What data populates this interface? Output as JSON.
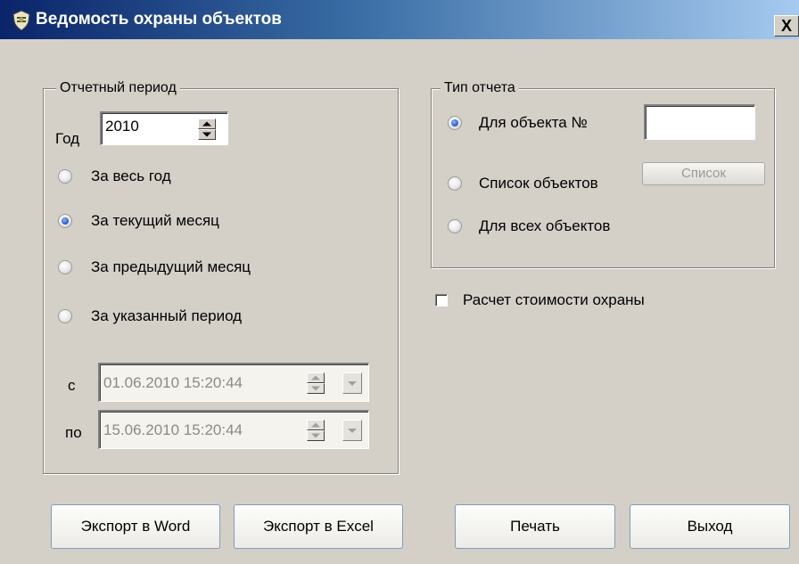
{
  "window": {
    "title": "Ведомость охраны объектов",
    "close_label": "X",
    "icon": "shield-app-icon"
  },
  "period_group": {
    "legend": "Отчетный период",
    "year_label": "Год",
    "year_value": "2010",
    "options": [
      {
        "label": "За весь год",
        "checked": false
      },
      {
        "label": "За текущий месяц",
        "checked": true
      },
      {
        "label": "За предыдущий месяц",
        "checked": false
      },
      {
        "label": "За указанный период",
        "checked": false
      }
    ],
    "from_label": "с",
    "from_value": "01.06.2010  15:20:44",
    "to_label": "по",
    "to_value": "15.06.2010  15:20:44"
  },
  "report_type_group": {
    "legend": "Тип отчета",
    "options": [
      {
        "label": "Для объекта №",
        "checked": true
      },
      {
        "label": "Список объектов",
        "checked": false
      },
      {
        "label": "Для всех объектов",
        "checked": false
      }
    ],
    "object_number_value": "",
    "list_button_label": "Список"
  },
  "cost_checkbox": {
    "label": "Расчет стоимости охраны",
    "checked": false
  },
  "buttons": {
    "export_word": "Экспорт в Word",
    "export_excel": "Экспорт в Excel",
    "print": "Печать",
    "exit": "Выход"
  },
  "colors": {
    "dialog_bg": "#d4d0c8",
    "title_start": "#0a246a",
    "title_end": "#a6caf0",
    "radio_selected": "#2457c5"
  }
}
